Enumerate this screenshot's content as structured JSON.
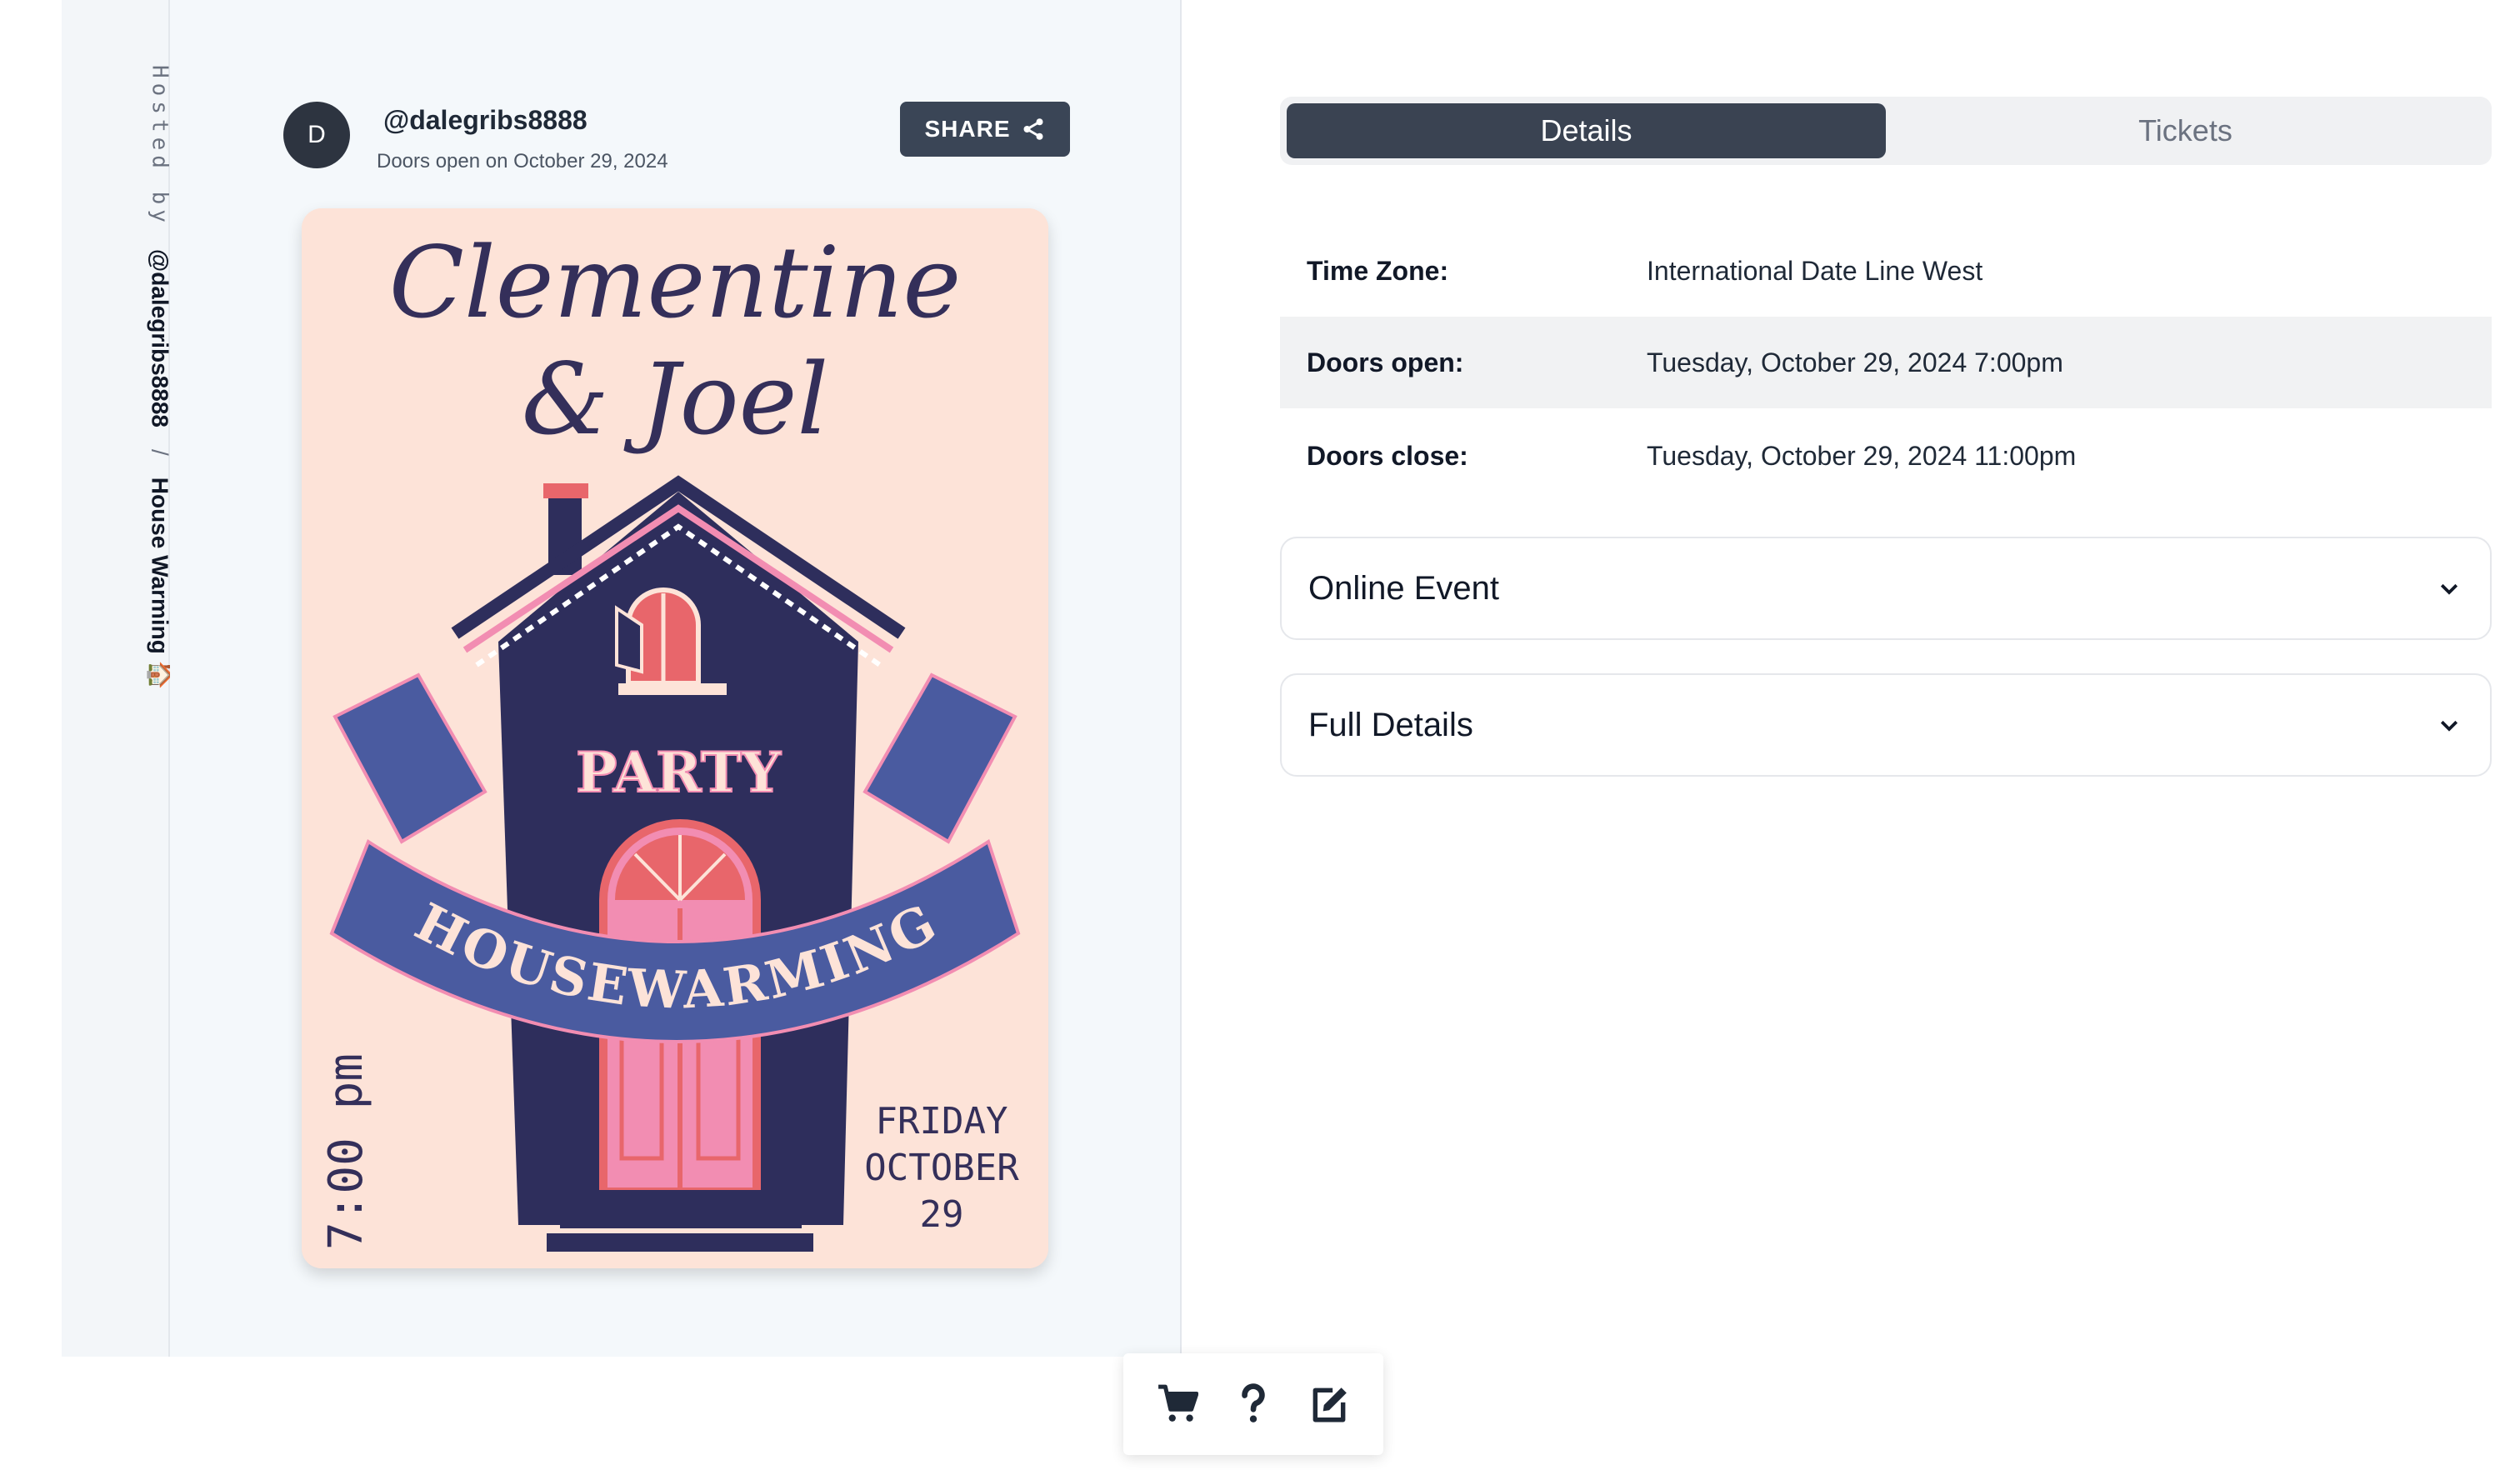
{
  "sidebar_strip": {
    "hosted_by": "Hosted by",
    "handle": "@dalegribs8888",
    "separator": "/",
    "event_name": "House Warming 🏠"
  },
  "host": {
    "avatar_initial": "D",
    "handle": "@dalegribs8888",
    "doors_line": "Doors open on October 29, 2024",
    "share_label": "SHARE"
  },
  "flyer": {
    "names_line1": "Clementine",
    "names_line2": "& Joel",
    "party": "PARTY",
    "banner": "HOUSEWARMING",
    "time": "7:00 pm",
    "day": "FRIDAY",
    "month": "OCTOBER",
    "date": "29"
  },
  "tabs": [
    {
      "label": "Details",
      "active": true
    },
    {
      "label": "Tickets",
      "active": false
    }
  ],
  "details": [
    {
      "label": "Time Zone:",
      "value": "International Date Line West"
    },
    {
      "label": "Doors open:",
      "value": "Tuesday, October 29, 2024 7:00pm"
    },
    {
      "label": "Doors close:",
      "value": "Tuesday, October 29, 2024 11:00pm"
    }
  ],
  "accordions": [
    {
      "label": "Online Event"
    },
    {
      "label": "Full Details"
    }
  ],
  "toolbar": {
    "icons": [
      "cart-icon",
      "help-icon",
      "edit-icon"
    ]
  },
  "colors": {
    "navy": "#2e2e5c",
    "flyer_bg": "#fde3d8",
    "pink": "#f28db2",
    "coral": "#e8666b",
    "blue": "#4a5ba0",
    "button": "#3a4556"
  }
}
